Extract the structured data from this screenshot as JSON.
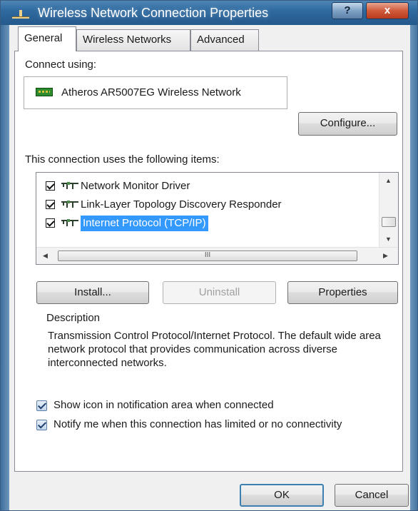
{
  "window": {
    "title": "Wireless Network Connection Properties",
    "help_button": "?",
    "close_button": "x"
  },
  "tabs": [
    {
      "label": "General",
      "active": true
    },
    {
      "label": "Wireless Networks",
      "active": false
    },
    {
      "label": "Advanced",
      "active": false
    }
  ],
  "general": {
    "connect_using_label": "Connect using:",
    "adapter_name": "Atheros AR5007EG Wireless Network",
    "configure_button": "Configure...",
    "items_label": "This connection uses the following items:",
    "items": [
      {
        "label": "Network Monitor Driver",
        "checked": true,
        "selected": false
      },
      {
        "label": "Link-Layer Topology Discovery Responder",
        "checked": true,
        "selected": false
      },
      {
        "label": "Internet Protocol (TCP/IP)",
        "checked": true,
        "selected": true
      }
    ],
    "hscroll_grip": "III",
    "install_button": "Install...",
    "uninstall_button": "Uninstall",
    "properties_button": "Properties",
    "description_label": "Description",
    "description_text": "Transmission Control Protocol/Internet Protocol. The default wide area network protocol that provides communication across diverse interconnected networks.",
    "show_icon_label": "Show icon in notification area when connected",
    "show_icon_checked": true,
    "notify_label": "Notify me when this connection has limited or no connectivity",
    "notify_checked": true
  },
  "footer": {
    "ok_button": "OK",
    "cancel_button": "Cancel"
  },
  "colors": {
    "titlebar": "#2f6aa0",
    "selection": "#3399ff",
    "default_button_border": "#3c7fb1"
  }
}
